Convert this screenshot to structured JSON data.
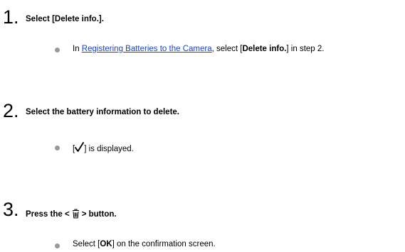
{
  "steps": [
    {
      "number": "1.",
      "heading": "Select [Delete info.].",
      "bullet": {
        "prefix": "In ",
        "link": "Registering Batteries to the Camera",
        "middle": ", select [",
        "bold": "Delete info.",
        "suffix": "] in step 2."
      }
    },
    {
      "number": "2.",
      "heading": "Select the battery information to delete.",
      "bullet": {
        "open": "[",
        "icon": "check-icon",
        "close": "] is displayed."
      }
    },
    {
      "number": "3.",
      "heading": {
        "before": "Press the <",
        "icon": "trash-icon",
        "after": "> button."
      },
      "bullet": {
        "prefix": "Select [",
        "bold": "OK",
        "suffix": "] on the confirmation screen."
      }
    }
  ],
  "colors": {
    "link": "#1a44c8",
    "bullet": "#999999",
    "text": "#000000"
  }
}
